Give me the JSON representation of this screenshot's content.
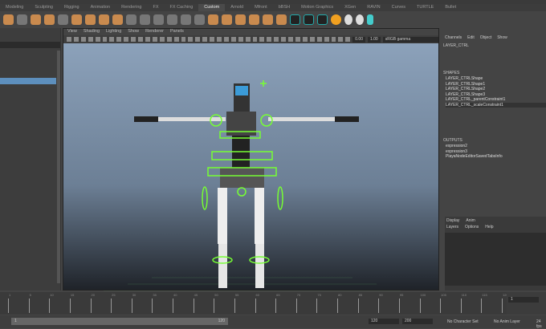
{
  "shelf_tabs": [
    "Modeling",
    "Sculpting",
    "Rigging",
    "Animation",
    "Rendering",
    "FX",
    "FX Caching",
    "Custom",
    "Arnold",
    "Mfront",
    "bBSH",
    "Motion Graphics",
    "XGen",
    "RAVIN",
    "Curves",
    "TURTLE",
    "Bullet"
  ],
  "active_shelf_tab": "Custom",
  "viewport": {
    "menu": [
      "View",
      "Shading",
      "Lighting",
      "Show",
      "Renderer",
      "Panels"
    ],
    "near": "0.00",
    "far": "1.00",
    "color_space": "sRGB gamma"
  },
  "channel_box": {
    "menu": [
      "Channels",
      "Edit",
      "Object",
      "Show"
    ],
    "object": "LAYER_CTRL",
    "shapes_header": "SHAPES",
    "shapes": [
      "LAYER_CTRLShape",
      "LAYER_CTRLShape1",
      "LAYER_CTRLShape2",
      "LAYER_CTRLShape3",
      "LAYER_CTRL_parentConstraint1",
      "LAYER_CTRL_scaleConstraint1"
    ],
    "outputs_header": "OUTPUTS",
    "outputs": [
      "expression2",
      "expression3",
      "PlayaNodeEditorSavedTabsInfo"
    ]
  },
  "layer_editor": {
    "tabs": [
      "Display",
      "Anim"
    ],
    "menu": [
      "Layers",
      "Options",
      "Help"
    ]
  },
  "timeline": {
    "ticks": [
      "1",
      "5",
      "10",
      "15",
      "20",
      "25",
      "30",
      "35",
      "40",
      "45",
      "50",
      "55",
      "60",
      "65",
      "70",
      "75",
      "80",
      "85",
      "90",
      "95",
      "100",
      "105",
      "110",
      "115",
      "120"
    ],
    "current_frame": "1"
  },
  "range": {
    "start": "1",
    "end": "120",
    "anim_end": "120",
    "max": "200",
    "character_set": "No Character Set",
    "anim_layer": "No Anim Layer",
    "fps": "24 fps"
  }
}
